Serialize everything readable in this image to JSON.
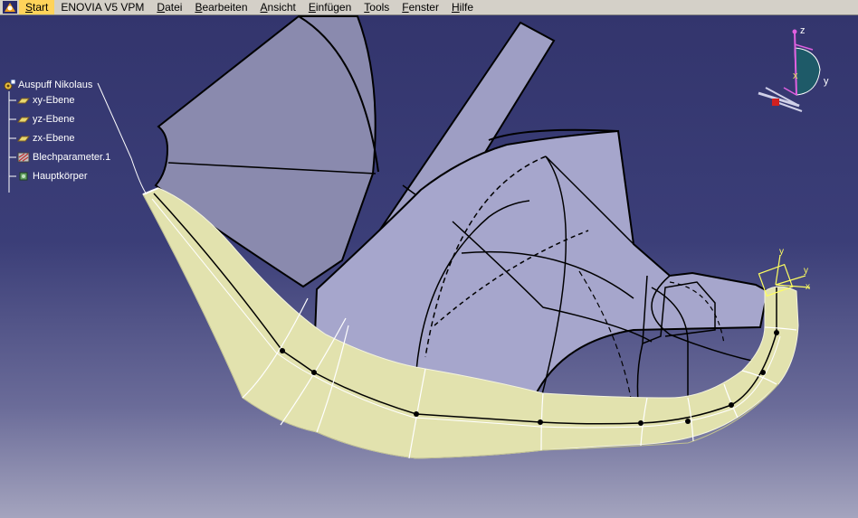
{
  "menubar": {
    "items": [
      {
        "label": "Start",
        "underline": "S",
        "rest": "tart",
        "active": true
      },
      {
        "label": "ENOVIA V5 VPM",
        "underline": "",
        "rest": "ENOVIA V5 VPM",
        "active": false
      },
      {
        "label": "Datei",
        "underline": "D",
        "rest": "atei",
        "active": false
      },
      {
        "label": "Bearbeiten",
        "underline": "B",
        "rest": "earbeiten",
        "active": false
      },
      {
        "label": "Ansicht",
        "underline": "A",
        "rest": "nsicht",
        "active": false
      },
      {
        "label": "Einfügen",
        "underline": "E",
        "rest": "infügen",
        "active": false
      },
      {
        "label": "Tools",
        "underline": "T",
        "rest": "ools",
        "active": false
      },
      {
        "label": "Fenster",
        "underline": "F",
        "rest": "enster",
        "active": false
      },
      {
        "label": "Hilfe",
        "underline": "H",
        "rest": "ilfe",
        "active": false
      }
    ]
  },
  "tree": {
    "root": {
      "label": "Auspuff Nikolaus",
      "icon": "product-icon"
    },
    "children": [
      {
        "label": "xy-Ebene",
        "icon": "plane-icon"
      },
      {
        "label": "yz-Ebene",
        "icon": "plane-icon"
      },
      {
        "label": "zx-Ebene",
        "icon": "plane-icon"
      },
      {
        "label": "Blechparameter.1",
        "icon": "sheet-metal-parameters-icon"
      },
      {
        "label": "Hauptkörper",
        "icon": "part-body-icon"
      }
    ]
  },
  "compass": {
    "z_label": "z",
    "x_label": "x",
    "y_label": "y"
  },
  "axis_marker": {
    "y_label": "y",
    "x_label": "x"
  },
  "colors": {
    "menu_bg": "#d4d0c8",
    "menu_active": "#ffd35a",
    "viewport_top": "#33356d",
    "viewport_bottom": "#a4a4be",
    "tube_fill": "#e4e4b0",
    "surface_fill": "#a6a6cc",
    "surface_fill_dark": "#8a8aae"
  }
}
